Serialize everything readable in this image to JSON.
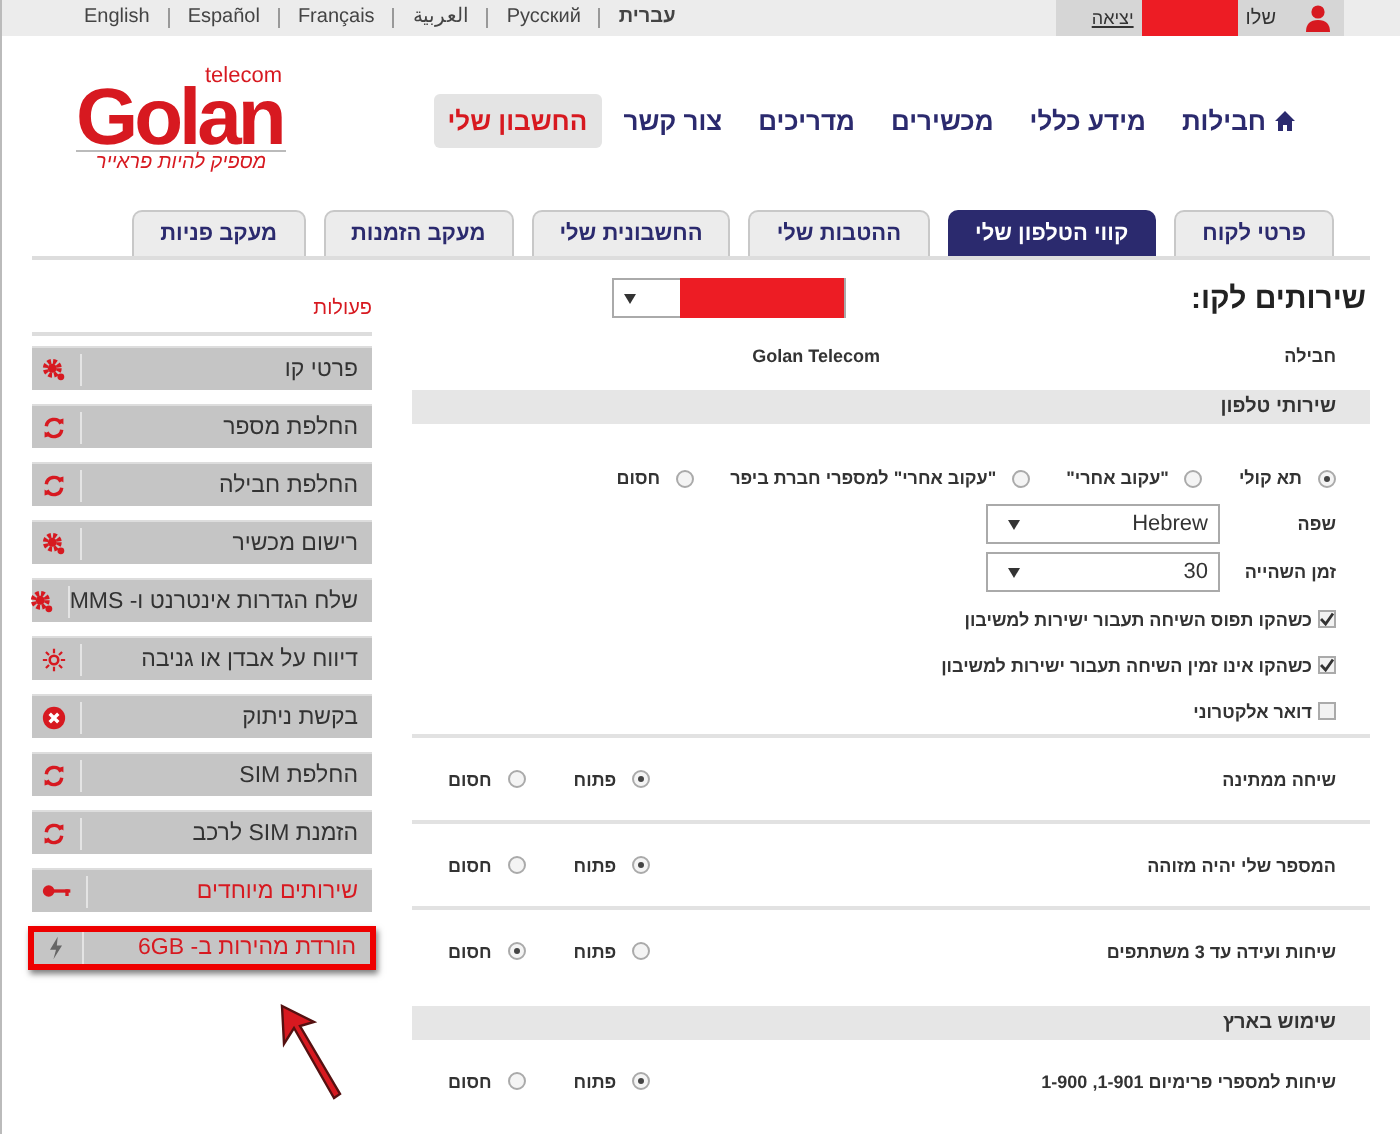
{
  "top_bar": {
    "languages": [
      {
        "label": "עברית",
        "selected": true
      },
      {
        "label": "Русский",
        "selected": false
      },
      {
        "label": "العربية",
        "selected": false
      },
      {
        "label": "Français",
        "selected": false
      },
      {
        "label": "Español",
        "selected": false
      },
      {
        "label": "English",
        "selected": false
      }
    ],
    "greeting": "שלו",
    "logout": "יציאה"
  },
  "logo": {
    "brand": "Golan",
    "sub": "telecom",
    "tagline": "מספיק להיות פראייר"
  },
  "nav": [
    {
      "label": "חבילות",
      "selected": false,
      "kind": "home"
    },
    {
      "label": "מידע כללי",
      "selected": false,
      "kind": "text"
    },
    {
      "label": "מכשירים",
      "selected": false,
      "kind": "text"
    },
    {
      "label": "מדריכים",
      "selected": false,
      "kind": "text"
    },
    {
      "label": "צור קשר",
      "selected": false,
      "kind": "text"
    },
    {
      "label": "החשבון שלי",
      "selected": true,
      "kind": "text"
    }
  ],
  "tabs": [
    {
      "label": "פרטי לקוח",
      "selected": false
    },
    {
      "label": "קווי הטלפון שלי",
      "selected": true
    },
    {
      "label": "ההטבות שלי",
      "selected": false
    },
    {
      "label": "החשבונית שלי",
      "selected": false
    },
    {
      "label": "מעקב הזמנות",
      "selected": false
    },
    {
      "label": "מעקב פניות",
      "selected": false
    }
  ],
  "main": {
    "title": "שירותים לקו:",
    "package": {
      "label": "חבילה",
      "value": "Golan Telecom"
    },
    "sections": [
      {
        "title": "שירותי טלפון",
        "items": [
          {
            "kind": "radio_group",
            "options": [
              {
                "label": "תא קולי",
                "selected": true
              },
              {
                "label": "\"עקוב אחרי\"",
                "selected": false
              },
              {
                "label": "\"עקוב אחרי\" למספרי חברת ביפר",
                "selected": false
              },
              {
                "label": "חסום",
                "selected": false
              }
            ]
          },
          {
            "kind": "select",
            "label": "שפה",
            "value": "Hebrew"
          },
          {
            "kind": "select",
            "label": "זמן השהייה",
            "value": "30"
          },
          {
            "kind": "checkbox",
            "label": "כשהקו תפוס השיחה תעבור ישירות למשיבון",
            "checked": true
          },
          {
            "kind": "checkbox",
            "label": "כשהקו אינו זמין השיחה תעבור ישירות למשיבון",
            "checked": true
          },
          {
            "kind": "checkbox",
            "label": "דואר אלקטרוני",
            "checked": false
          },
          {
            "kind": "toggle",
            "label": "שיחה ממתינה",
            "options": [
              {
                "label": "פתוח",
                "selected": true
              },
              {
                "label": "חסום",
                "selected": false
              }
            ]
          },
          {
            "kind": "toggle",
            "label": "המספר שלי יהיה מזוהה",
            "options": [
              {
                "label": "פתוח",
                "selected": true
              },
              {
                "label": "חסום",
                "selected": false
              }
            ]
          },
          {
            "kind": "toggle",
            "label": "שיחות ועידה עד 3 משתתפים",
            "options": [
              {
                "label": "פתוח",
                "selected": false
              },
              {
                "label": "חסום",
                "selected": true
              }
            ]
          }
        ]
      },
      {
        "title": "שימוש בארץ",
        "items": [
          {
            "kind": "toggle",
            "label": "שיחות למספרי פרימיום 1-901, 1-900",
            "options": [
              {
                "label": "פתוח",
                "selected": true
              },
              {
                "label": "חסום",
                "selected": false
              }
            ]
          }
        ]
      }
    ]
  },
  "sidebar": {
    "title": "פעולות",
    "items": [
      {
        "label": "פרטי קו",
        "kind": "gear",
        "emphasized": false,
        "outlined": false
      },
      {
        "label": "החלפת מספר",
        "kind": "refresh",
        "emphasized": false,
        "outlined": false
      },
      {
        "label": "החלפת חבילה",
        "kind": "refresh",
        "emphasized": false,
        "outlined": false
      },
      {
        "label": "רישום מכשיר",
        "kind": "gear",
        "emphasized": false,
        "outlined": false
      },
      {
        "label": "שלח הגדרות אינטרנט ו- MMS",
        "kind": "gear",
        "emphasized": false,
        "outlined": false
      },
      {
        "label": "דיווח על אבדן או גניבה",
        "kind": "sun",
        "emphasized": false,
        "outlined": false
      },
      {
        "label": "בקשת ניתוק",
        "kind": "cancel",
        "emphasized": false,
        "outlined": false
      },
      {
        "label": "החלפת SIM",
        "kind": "refresh",
        "emphasized": false,
        "outlined": false
      },
      {
        "label": "הזמנת SIM לרכב",
        "kind": "refresh",
        "emphasized": false,
        "outlined": false
      },
      {
        "label": "שירותים מיוחדים",
        "kind": "key",
        "emphasized": true,
        "outlined": false
      },
      {
        "label": "הורדת מהירות ב- 6GB",
        "kind": "bolt",
        "emphasized": true,
        "outlined": true
      }
    ]
  }
}
